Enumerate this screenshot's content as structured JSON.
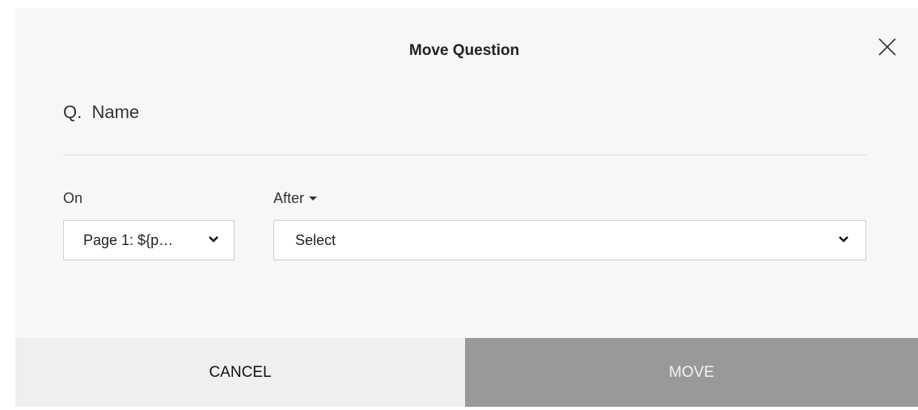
{
  "dialog": {
    "title": "Move Question",
    "close_icon": "close-icon",
    "question_label": "Q.  Name"
  },
  "form": {
    "on_label": "On",
    "after_label": "After",
    "page_select_value": "Page 1: ${p…",
    "position_select_value": "Select"
  },
  "footer": {
    "cancel_label": "CANCEL",
    "move_label": "MOVE"
  },
  "colors": {
    "move_button_bg": "#999999",
    "cancel_button_bg": "#efefef",
    "dialog_bg": "#f7f7f7"
  }
}
